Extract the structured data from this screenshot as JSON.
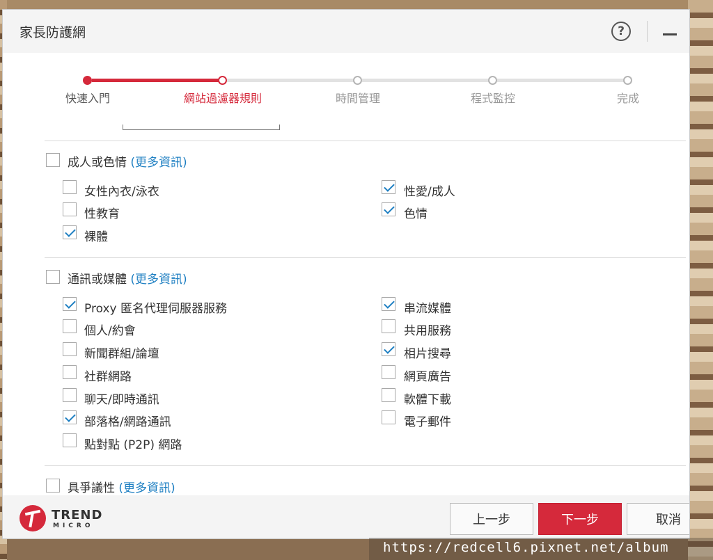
{
  "window": {
    "title": "家長防護網"
  },
  "stepper": {
    "steps": [
      {
        "label": "快速入門"
      },
      {
        "label": "網站過濾器規則"
      },
      {
        "label": "時間管理"
      },
      {
        "label": "程式監控"
      },
      {
        "label": "完成"
      }
    ]
  },
  "icons": {
    "help": "?",
    "close": "×"
  },
  "categories": [
    {
      "label": "成人或色情",
      "more": "(更多資訊)",
      "checked": false,
      "items": [
        {
          "label": "女性內衣/泳衣",
          "checked": false
        },
        {
          "label": "性愛/成人",
          "checked": true
        },
        {
          "label": "性教育",
          "checked": false
        },
        {
          "label": "色情",
          "checked": true
        },
        {
          "label": "裸體",
          "checked": true
        }
      ]
    },
    {
      "label": "通訊或媒體",
      "more": "(更多資訊)",
      "checked": false,
      "items": [
        {
          "label": "Proxy 匿名代理伺服器服務",
          "checked": true
        },
        {
          "label": "串流媒體",
          "checked": true
        },
        {
          "label": "個人/約會",
          "checked": false
        },
        {
          "label": "共用服務",
          "checked": false
        },
        {
          "label": "新聞群組/論壇",
          "checked": false
        },
        {
          "label": "相片搜尋",
          "checked": true
        },
        {
          "label": "社群網路",
          "checked": false
        },
        {
          "label": "網頁廣告",
          "checked": false
        },
        {
          "label": "聊天/即時通訊",
          "checked": false
        },
        {
          "label": "軟體下載",
          "checked": false
        },
        {
          "label": "部落格/網路通訊",
          "checked": true
        },
        {
          "label": "電子郵件",
          "checked": false
        },
        {
          "label": "點對點 (P2P) 網路",
          "checked": false
        }
      ]
    },
    {
      "label": "具爭議性",
      "more": "(更多資訊)",
      "checked": false
    }
  ],
  "footer": {
    "brand": "TREND",
    "brand_sub": "MICRO",
    "back_label": "上一步",
    "next_label": "下一步",
    "cancel_label": "取消"
  },
  "watermark": "https://redcell6.pixnet.net/album",
  "colors": {
    "accent": "#d5293b",
    "link": "#1e7fc2"
  }
}
